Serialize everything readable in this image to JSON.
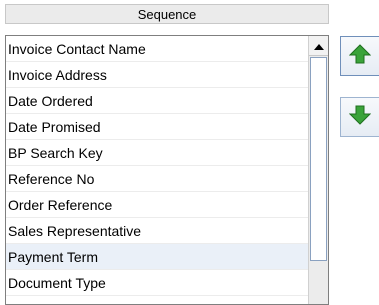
{
  "header": {
    "title": "Sequence"
  },
  "list": {
    "items": [
      {
        "label": "Invoice Contact Name",
        "selected": false
      },
      {
        "label": "Invoice Address",
        "selected": false
      },
      {
        "label": "Date Ordered",
        "selected": false
      },
      {
        "label": "Date Promised",
        "selected": false
      },
      {
        "label": "BP Search Key",
        "selected": false
      },
      {
        "label": "Reference No",
        "selected": false
      },
      {
        "label": "Order Reference",
        "selected": false
      },
      {
        "label": "Sales Representative",
        "selected": false
      },
      {
        "label": "Payment Term",
        "selected": true
      },
      {
        "label": "Document Type",
        "selected": false
      }
    ]
  },
  "icons": {
    "scroll_up": "triangle-up-icon",
    "move_up": "green-arrow-up-icon",
    "move_down": "green-arrow-down-icon"
  },
  "colors": {
    "selected_row": "#eaf0f8",
    "arrow_green": "#3aa33a"
  }
}
